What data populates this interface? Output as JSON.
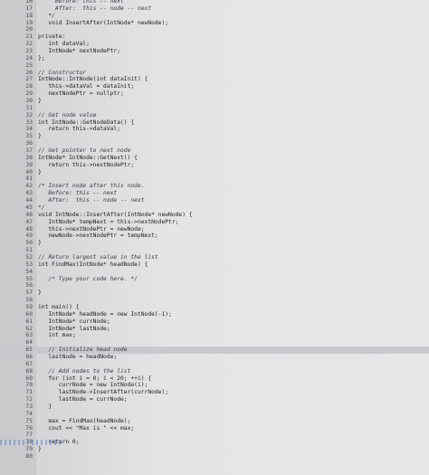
{
  "editor": {
    "lines": [
      {
        "n": "16",
        "t": "     Before: this -- next",
        "c": true
      },
      {
        "n": "17",
        "t": "     After:  this -- node -- next",
        "c": true
      },
      {
        "n": "18",
        "t": "   */",
        "c": true
      },
      {
        "n": "19",
        "t": "   void InsertAfter(IntNode* newNode);"
      },
      {
        "n": "20",
        "t": ""
      },
      {
        "n": "21",
        "t": "private:"
      },
      {
        "n": "22",
        "t": "   int dataVal;"
      },
      {
        "n": "23",
        "t": "   IntNode* nextNodePtr;"
      },
      {
        "n": "24",
        "t": "};"
      },
      {
        "n": "25",
        "t": ""
      },
      {
        "n": "26",
        "t": "// Constructor",
        "c": true
      },
      {
        "n": "27",
        "t": "IntNode::IntNode(int dataInit) {"
      },
      {
        "n": "28",
        "t": "   this->dataVal = dataInit;"
      },
      {
        "n": "29",
        "t": "   nextNodePtr = nullptr;"
      },
      {
        "n": "30",
        "t": "}"
      },
      {
        "n": "31",
        "t": ""
      },
      {
        "n": "32",
        "t": "// Get node value",
        "c": true
      },
      {
        "n": "33",
        "t": "int IntNode::GetNodeData() {"
      },
      {
        "n": "34",
        "t": "   return this->dataVal;"
      },
      {
        "n": "35",
        "t": "}"
      },
      {
        "n": "36",
        "t": ""
      },
      {
        "n": "37",
        "t": "// Get pointer to next node",
        "c": true
      },
      {
        "n": "38",
        "t": "IntNode* IntNode::GetNext() {"
      },
      {
        "n": "39",
        "t": "   return this->nextNodePtr;"
      },
      {
        "n": "40",
        "t": "}"
      },
      {
        "n": "41",
        "t": ""
      },
      {
        "n": "42",
        "t": "/* Insert node after this node.",
        "c": true
      },
      {
        "n": "43",
        "t": "   Before: this -- next",
        "c": true
      },
      {
        "n": "44",
        "t": "   After:  this -- node -- next",
        "c": true
      },
      {
        "n": "45",
        "t": "*/",
        "c": true
      },
      {
        "n": "46",
        "t": "void IntNode::InsertAfter(IntNode* newNode) {"
      },
      {
        "n": "47",
        "t": "   IntNode* tempNext = this->nextNodePtr;"
      },
      {
        "n": "48",
        "t": "   this->nextNodePtr = newNode;"
      },
      {
        "n": "49",
        "t": "   newNode->nextNodePtr = tempNext;"
      },
      {
        "n": "50",
        "t": "}"
      },
      {
        "n": "51",
        "t": ""
      },
      {
        "n": "52",
        "t": "// Return largest value in the list",
        "c": true
      },
      {
        "n": "53",
        "t": "int FindMax(IntNode* headNode) {"
      },
      {
        "n": "54",
        "t": ""
      },
      {
        "n": "55",
        "t": "   /* Type your code here. */",
        "c": true
      },
      {
        "n": "56",
        "t": ""
      },
      {
        "n": "57",
        "t": "}"
      },
      {
        "n": "58",
        "t": ""
      },
      {
        "n": "59",
        "t": "int main() {"
      },
      {
        "n": "60",
        "t": "   IntNode* headNode = new IntNode(-1);"
      },
      {
        "n": "61",
        "t": "   IntNode* currNode;"
      },
      {
        "n": "62",
        "t": "   IntNode* lastNode;"
      },
      {
        "n": "63",
        "t": "   int max;"
      },
      {
        "n": "64",
        "t": ""
      },
      {
        "n": "65",
        "t": "   // Initialize head node",
        "c": true,
        "hl": true
      },
      {
        "n": "66",
        "t": "   lastNode = headNode;"
      },
      {
        "n": "67",
        "t": ""
      },
      {
        "n": "68",
        "t": "   // Add nodes to the list",
        "c": true
      },
      {
        "n": "69",
        "t": "   for (int i = 0; i < 20; ++i) {"
      },
      {
        "n": "70",
        "t": "      currNode = new IntNode(i);"
      },
      {
        "n": "71",
        "t": "      lastNode->InsertAfter(currNode);"
      },
      {
        "n": "72",
        "t": "      lastNode = currNode;"
      },
      {
        "n": "73",
        "t": "   }"
      },
      {
        "n": "74",
        "t": ""
      },
      {
        "n": "75",
        "t": "   max = FindMax(headNode);"
      },
      {
        "n": "76",
        "t": "   cout << \"Max is \" << max;"
      },
      {
        "n": "77",
        "t": ""
      },
      {
        "n": "78",
        "t": "   return 0;"
      },
      {
        "n": "79",
        "t": "}"
      },
      {
        "n": "80",
        "t": ""
      }
    ]
  }
}
